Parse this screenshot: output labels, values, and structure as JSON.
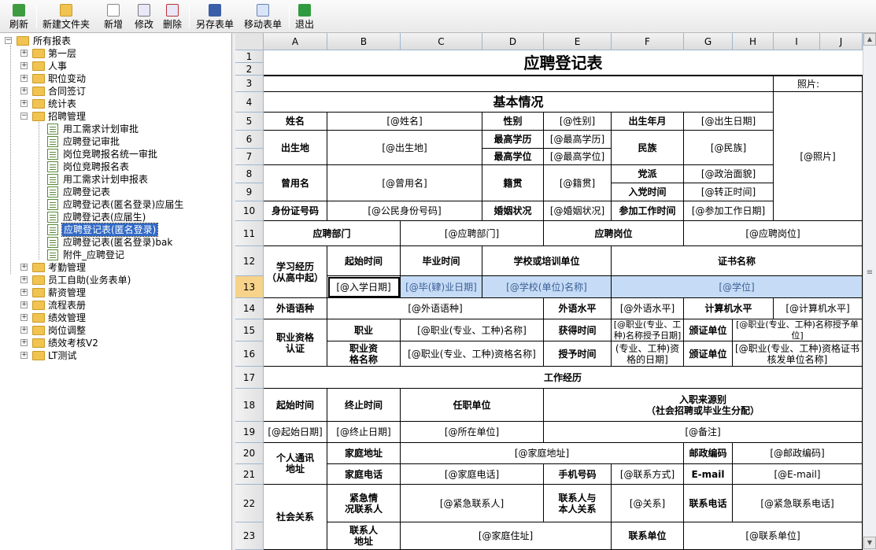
{
  "toolbar": {
    "refresh": "刷新",
    "new_folder": "新建文件夹",
    "new": "新增",
    "edit": "修改",
    "delete": "删除",
    "save_as": "另存表单",
    "move": "移动表单",
    "exit": "退出"
  },
  "tree": {
    "root": "所有报表",
    "folders_top": [
      "第一层",
      "人事",
      "职位变动",
      "合同签订",
      "统计表",
      "招聘管理"
    ],
    "children": [
      "用工需求计划审批",
      "应聘登记审批",
      "岗位竞聘报名统一审批",
      "岗位竞聘报名表",
      "用工需求计划申报表",
      "应聘登记表",
      "应聘登记表(匿名登录)应届生",
      "应聘登记表(应届生)",
      "应聘登记表(匿名登录)",
      "应聘登记表(匿名登录)bak",
      "附件_应聘登记"
    ],
    "selected_child": "应聘登记表(匿名登录)",
    "folders_bottom": [
      "考勤管理",
      "员工自助(业务表单)",
      "薪资管理",
      "流程表册",
      "绩效管理",
      "岗位调整",
      "绩效考核V2",
      "LT测试"
    ]
  },
  "grid": {
    "columns": [
      "A",
      "B",
      "C",
      "D",
      "E",
      "F",
      "G",
      "H",
      "I",
      "J"
    ],
    "rows": [
      "1",
      "2",
      "3",
      "4",
      "5",
      "6",
      "7",
      "8",
      "9",
      "10",
      "11",
      "12",
      "13",
      "14",
      "15",
      "16",
      "17",
      "18",
      "19",
      "20",
      "21",
      "22",
      "23"
    ],
    "selected_row": "13"
  },
  "form": {
    "title": "应聘登记表",
    "photo_label": "照片:",
    "basic_section": "基本情况",
    "name_label": "姓名",
    "name_val": "[@姓名]",
    "gender_label": "性别",
    "gender_val": "[@性别]",
    "birth_label": "出生年月",
    "birth_val": "[@出生日期]",
    "origin_label": "出生地",
    "origin_val": "[@出生地]",
    "edu_label": "最高学历",
    "edu_val": "[@最高学历]",
    "degree_label": "最高学位",
    "degree_val": "[@最高学位]",
    "nation_label": "民族",
    "nation_val": "[@民族]",
    "photo_val": "[@照片]",
    "former_label": "曾用名",
    "former_val": "[@曾用名]",
    "native_label": "籍贯",
    "native_val": "[@籍贯]",
    "party_label": "党派",
    "party_val": "[@政治面貌]",
    "join_party_label": "入党时间",
    "join_party_val": "[@转正时间]",
    "id_label": "身份证号码",
    "id_val": "[@公民身份号码]",
    "marital_label": "婚姻状况",
    "marital_val": "[@婚姻状况]",
    "work_start_label": "参加工作时间",
    "work_start_val": "[@参加工作日期]",
    "dept_label": "应聘部门",
    "dept_val": "[@应聘部门]",
    "post_label": "应聘岗位",
    "post_val": "[@应聘岗位]",
    "study_label": "学习经历\n（从高中起）",
    "start_label": "起始时间",
    "grad_label": "毕业时间",
    "school_label": "学校或培训单位",
    "cert_label": "证书名称",
    "start_val": "[@入学日期]",
    "grad_val": "[@毕(肄)业日期]",
    "school_val": "[@学校(单位)名称]",
    "cert_val": "[@学位]",
    "lang_label": "外语语种",
    "lang_val": "[@外语语种]",
    "lang_level_label": "外语水平",
    "lang_level_val": "[@外语水平]",
    "pc_label": "计算机水平",
    "pc_val": "[@计算机水平]",
    "qual_label": "职业资格\n认证",
    "job_label": "职业",
    "job_val": "[@职业(专业、工种)名称]",
    "got_time_label": "获得时间",
    "got_time_val": "[@职业(专业、工种)名称授予日期]",
    "issuer_label": "颁证单位",
    "issuer_val": "[@职业(专业、工种)名称授予单位]",
    "qual_name_label": "职业资\n格名称",
    "qual_name_val": "[@职业(专业、工种)资格名称]",
    "grant_time_label": "授予时间",
    "grant_time_val": "(专业、工种)资格的日期]",
    "issuer2_label": "颁证单位",
    "issuer2_val": "[@职业(专业、工种)资格证书核发单位名称]",
    "work_section": "工作经历",
    "w_start_label": "起始时间",
    "w_end_label": "终止时间",
    "w_unit_label": "任职单位",
    "w_source_label": "入职来源别\n（社会招聘或毕业生分配）",
    "w_start_val": "[@起始日期]",
    "w_end_val": "[@终止日期]",
    "w_unit_val": "[@所在单位]",
    "w_source_val": "[@备注]",
    "contact_label": "个人通讯\n地址",
    "home_addr_label": "家庭地址",
    "home_addr_val": "[@家庭地址]",
    "zip_label": "邮政编码",
    "zip_val": "[@邮政编码]",
    "home_tel_label": "家庭电话",
    "home_tel_val": "[@家庭电话]",
    "mobile_label": "手机号码",
    "mobile_val": "[@联系方式]",
    "email_label": "E-mail",
    "email_val": "[@E-mail]",
    "social_label": "社会关系",
    "emerg_label": "紧急情\n况联系人",
    "emerg_val": "[@紧急联系人]",
    "rel_label": "联系人与\n本人关系",
    "rel_val": "[@关系]",
    "emerg_tel_label": "联系电话",
    "emerg_tel_val": "[@紧急联系电话]",
    "contact_person_label": "联系人\n地址",
    "contact_person_val": "[@家庭住址]",
    "contact_unit_label": "联系单位",
    "contact_unit_val": "[@联系单位]"
  },
  "colors": {
    "accent": "#3169c6",
    "highlight": "#c6dcf6",
    "folder": "#f1c350"
  }
}
